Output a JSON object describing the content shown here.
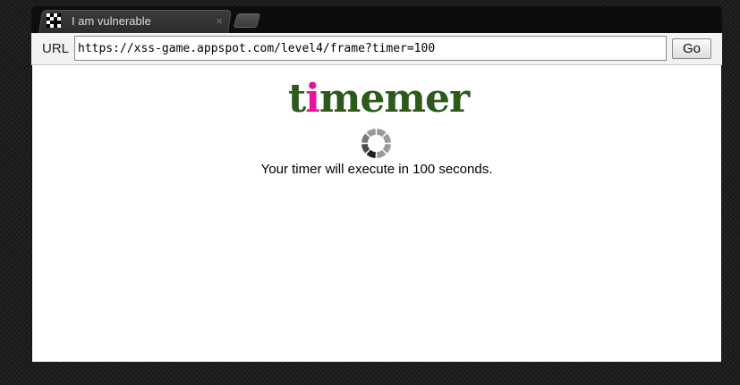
{
  "tab": {
    "title": "I am vulnerable",
    "close_glyph": "×",
    "favicon": "checkered-favicon-icon"
  },
  "toolbar": {
    "url_label": "URL",
    "url_value": "https://xss-game.appspot.com/level4/frame?timer=100",
    "go_label": "Go"
  },
  "page": {
    "logo": {
      "part1": "t",
      "part2": "i",
      "part3": "memer",
      "color_main": "#2d5a1b",
      "color_accent": "#e8119a"
    },
    "spinner_icon": "loading-spinner-icon",
    "message": "Your timer will execute in 100 seconds."
  }
}
